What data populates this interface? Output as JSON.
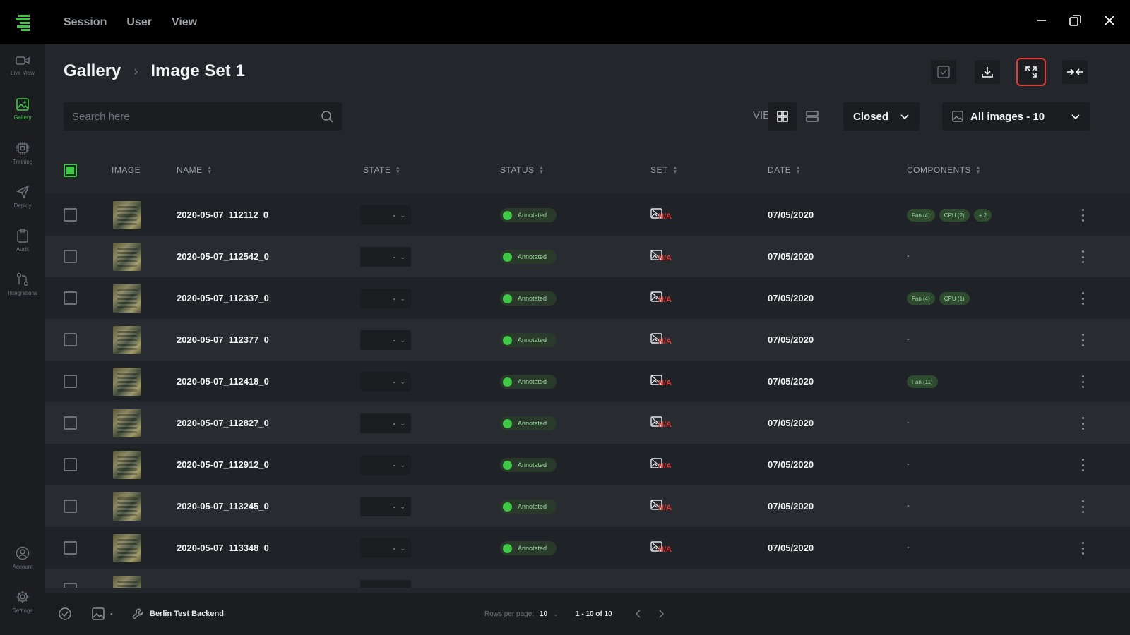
{
  "menu": [
    "Session",
    "User",
    "View"
  ],
  "sidebar": [
    {
      "label": "Live View",
      "icon": "video-camera-icon"
    },
    {
      "label": "Gallery",
      "icon": "image-icon",
      "active": true
    },
    {
      "label": "Training",
      "icon": "chip-icon"
    },
    {
      "label": "Deploy",
      "icon": "send-icon"
    },
    {
      "label": "Audit",
      "icon": "clipboard-icon"
    },
    {
      "label": "Integrations",
      "icon": "integrations-icon"
    },
    {
      "label": "Account",
      "icon": "user-icon"
    },
    {
      "label": "Settings",
      "icon": "gear-icon"
    }
  ],
  "breadcrumb": {
    "root": "Gallery",
    "current": "Image Set 1"
  },
  "search": {
    "placeholder": "Search here"
  },
  "view": {
    "label": "VIEW",
    "mode": "grid"
  },
  "filters": {
    "state": "Closed",
    "images": "All images - 10"
  },
  "columns": {
    "image": "IMAGE",
    "name": "NAME",
    "state": "STATE",
    "status": "STATUS",
    "set": "SET",
    "date": "DATE",
    "components": "COMPONENTS"
  },
  "rows": [
    {
      "name": "2020-05-07_112112_0",
      "state": "-",
      "status": "Annotated",
      "set": "N/A",
      "date": "07/05/2020",
      "components": [
        "Fan (4)",
        "CPU (2)",
        "+ 2"
      ]
    },
    {
      "name": "2020-05-07_112542_0",
      "state": "-",
      "status": "Annotated",
      "set": "N/A",
      "date": "07/05/2020",
      "components": []
    },
    {
      "name": "2020-05-07_112337_0",
      "state": "-",
      "status": "Annotated",
      "set": "N/A",
      "date": "07/05/2020",
      "components": [
        "Fan (4)",
        "CPU (1)"
      ]
    },
    {
      "name": "2020-05-07_112377_0",
      "state": "-",
      "status": "Annotated",
      "set": "N/A",
      "date": "07/05/2020",
      "components": []
    },
    {
      "name": "2020-05-07_112418_0",
      "state": "-",
      "status": "Annotated",
      "set": "N/A",
      "date": "07/05/2020",
      "components": [
        "Fan (11)"
      ]
    },
    {
      "name": "2020-05-07_112827_0",
      "state": "-",
      "status": "Annotated",
      "set": "N/A",
      "date": "07/05/2020",
      "components": []
    },
    {
      "name": "2020-05-07_112912_0",
      "state": "-",
      "status": "Annotated",
      "set": "N/A",
      "date": "07/05/2020",
      "components": []
    },
    {
      "name": "2020-05-07_113245_0",
      "state": "-",
      "status": "Annotated",
      "set": "N/A",
      "date": "07/05/2020",
      "components": []
    },
    {
      "name": "2020-05-07_113348_0",
      "state": "-",
      "status": "Annotated",
      "set": "N/A",
      "date": "07/05/2020",
      "components": []
    }
  ],
  "empty_components": "-",
  "footer": {
    "image_count": "-",
    "backend": "Berlin Test Backend",
    "rows_per_page_label": "Rows per page:",
    "rows_per_page": "10",
    "range": "1 - 10 of 10"
  },
  "colors": {
    "accent": "#3fc846",
    "alert": "#e53935",
    "background": "#23262b"
  }
}
